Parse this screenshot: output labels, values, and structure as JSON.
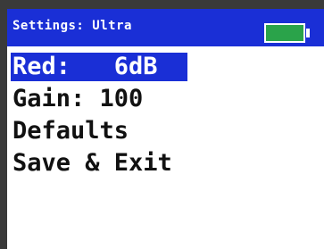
{
  "header": {
    "title": "Settings: Ultra",
    "battery_level": 1.0
  },
  "menu": {
    "items": [
      {
        "label": "Red:   6dB",
        "selected": true
      },
      {
        "label": "Gain: 100",
        "selected": false
      },
      {
        "label": "Defaults",
        "selected": false
      },
      {
        "label": "Save & Exit",
        "selected": false
      }
    ]
  },
  "colors": {
    "header_bg": "#1a2fd6",
    "selection_bg": "#1a2fd6",
    "battery_fill": "#2aa34a",
    "screen_bg": "#ffffff",
    "text": "#111111"
  }
}
